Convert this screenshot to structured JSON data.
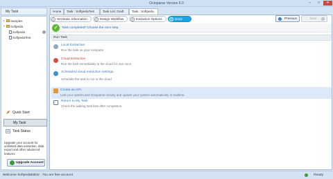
{
  "window": {
    "title": "Octoparse Version 6.0",
    "minimize": "–",
    "maximize": "□",
    "close": "✕"
  },
  "sidebar": {
    "header": "My Task",
    "tree": [
      {
        "label": "Samples",
        "toggle": "▸"
      },
      {
        "label": "Softpeda",
        "toggle": "▾"
      },
      {
        "label": "Softpeda"
      },
      {
        "label": "SoftpedaTest"
      }
    ],
    "nav": [
      {
        "label": "Quick Start"
      },
      {
        "label": "My Task"
      },
      {
        "label": "Task Status"
      }
    ],
    "upgrade_text": "Upgrade your account for unlimited data extraction, data export and other advanced features.",
    "upgrade_button": "Upgrade Account"
  },
  "tabs": [
    {
      "label": "Home"
    },
    {
      "label": "Task : SoftpedaTest"
    },
    {
      "label": "Task List: Draft"
    },
    {
      "label": "Task : Softpeda"
    }
  ],
  "steps": [
    {
      "num": "1",
      "label": "Set Basic Information"
    },
    {
      "num": "2",
      "label": "Design Workflow"
    },
    {
      "num": "3",
      "label": "Extraction Options"
    },
    {
      "num": "4",
      "label": "Done"
    }
  ],
  "nav_buttons": {
    "previous": "Previous",
    "next": "Next",
    "prev_arrow": "‹",
    "next_arrow": "›"
  },
  "done": {
    "check": "✓",
    "message": "Task completed! Choose the next step."
  },
  "run_task": {
    "header": "Run Task",
    "options": [
      {
        "title": "Local Extraction",
        "desc": "Run the task on your computer"
      },
      {
        "title": "Cloud Extraction",
        "desc": "Run the task immediately in the cloud for one once"
      },
      {
        "title": "Scheduled cloud extraction settings",
        "desc": "Schedule the task to run in the cloud"
      }
    ]
  },
  "api": {
    "title": "Create an API",
    "desc": "Link your system and Octoparse closely and update your system automatically in realtime."
  },
  "return": {
    "title": "Return to My Task",
    "desc": "Check the waiting task lists after completion."
  },
  "status": {
    "left": "Welcome  SoftpedaEditor , You are free account",
    "right": "Ready"
  },
  "colors": {
    "accent": "#1aa6e6",
    "success": "#5fb832",
    "link": "#3a7bbf",
    "cloud": "#c7382e"
  }
}
